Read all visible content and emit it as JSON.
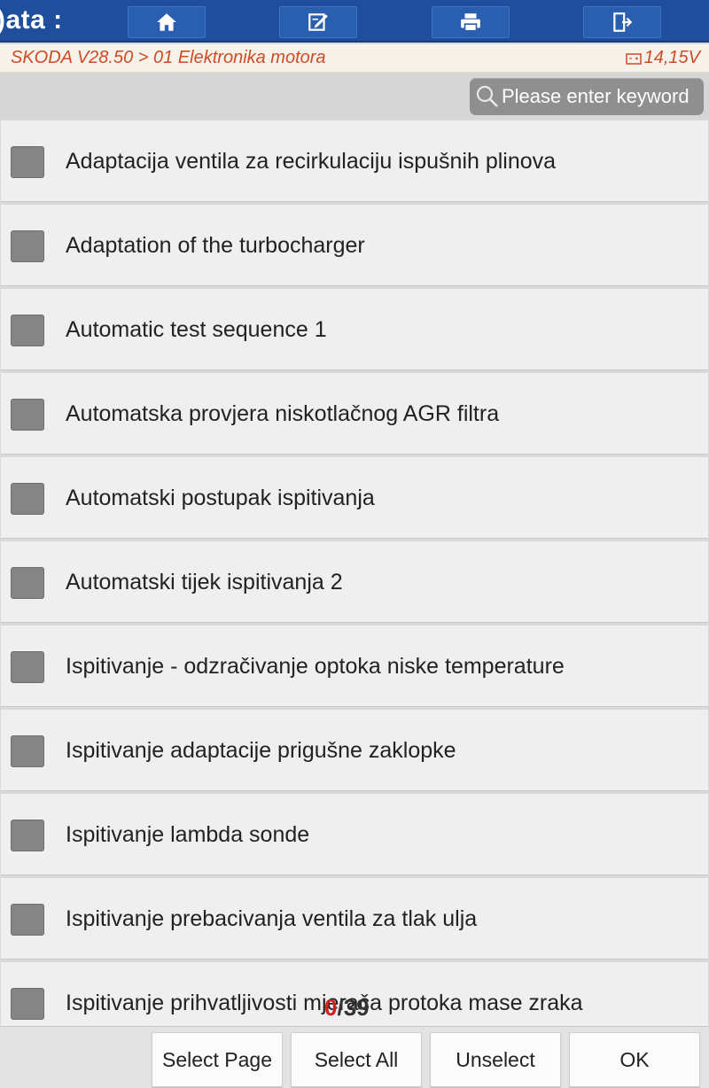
{
  "header": {
    "title": ")ata :",
    "nav": [
      {
        "icon": "home-icon"
      },
      {
        "icon": "edit-icon"
      },
      {
        "icon": "print-icon"
      },
      {
        "icon": "exit-icon"
      }
    ],
    "brand_color": "#1f4f9c"
  },
  "breadcrumb": {
    "path": "SKODA V28.50 > 01 Elektronika motora",
    "voltage": "14,15V",
    "voltage_icon": "battery-icon"
  },
  "search": {
    "placeholder": "Please enter keyword",
    "icon": "search-icon"
  },
  "list": {
    "items": [
      {
        "label": "Adaptacija ventila za recirkulaciju ispušnih plinova",
        "checked": false
      },
      {
        "label": "Adaptation of the turbocharger",
        "checked": false
      },
      {
        "label": "Automatic test sequence 1",
        "checked": false
      },
      {
        "label": "Automatska provjera niskotlačnog AGR filtra",
        "checked": false
      },
      {
        "label": "Automatski postupak ispitivanja",
        "checked": false
      },
      {
        "label": "Automatski tijek ispitivanja 2",
        "checked": false
      },
      {
        "label": "Ispitivanje - odzračivanje optoka niske temperature",
        "checked": false
      },
      {
        "label": "Ispitivanje adaptacije prigušne zaklopke",
        "checked": false
      },
      {
        "label": "Ispitivanje lambda sonde",
        "checked": false
      },
      {
        "label": "Ispitivanje prebacivanja ventila za tlak ulja",
        "checked": false
      },
      {
        "label": "Ispitivanje prihvatljivosti mjerača protoka mase zraka",
        "checked": false
      }
    ]
  },
  "counter": {
    "selected": "0",
    "separator": "/",
    "total": "39"
  },
  "footer": {
    "select_page": "Select Page",
    "select_all": "Select All",
    "unselect": "Unselect",
    "ok": "OK"
  }
}
